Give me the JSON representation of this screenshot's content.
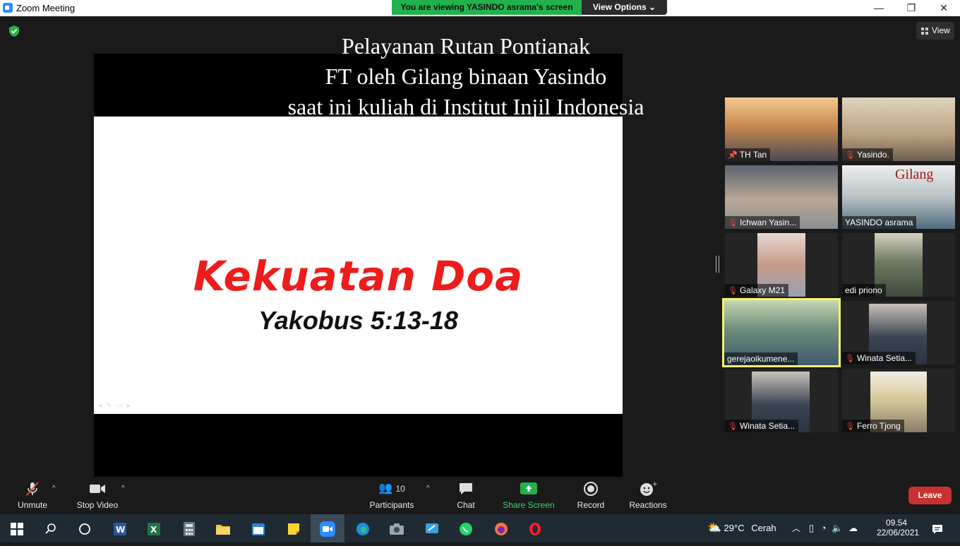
{
  "window": {
    "title": "Zoom Meeting",
    "share_banner": "You are viewing YASINDO asrama's screen",
    "view_options": "View Options",
    "minimize": "—",
    "restore": "❐",
    "close": "✕"
  },
  "view_button": "View",
  "shared_screen": {
    "caption_lines": [
      "Pelayanan Rutan Pontianak",
      "FT oleh Gilang binaan Yasindo",
      "saat ini kuliah di Institut Injil Indonesia"
    ],
    "slide_title": "Kekuatan Doa",
    "slide_subtitle": "Yakobus 5:13-18"
  },
  "participants": [
    {
      "name": "TH Tan",
      "muted": false,
      "pinned": true,
      "bg": "#b98f6a"
    },
    {
      "name": "Yasindo.",
      "muted": true,
      "bg": "#c7b59c"
    },
    {
      "name": "Ichwan Yasin...",
      "muted": true,
      "bg": "#7d8791"
    },
    {
      "name": "YASINDO asrama",
      "muted": false,
      "bg": "#9aa7a0",
      "overlay": "Gilang"
    },
    {
      "name": "Galaxy M21",
      "muted": true,
      "bg": "#caa79a"
    },
    {
      "name": "edi priono",
      "muted": false,
      "bg": "#5f6a58"
    },
    {
      "name": "gerejaoikumene...",
      "muted": false,
      "bg": "#6f8c7a"
    },
    {
      "name": "Winata Setia...",
      "muted": true,
      "bg": "#3c4450"
    },
    {
      "name": "Winata Setia...",
      "muted": true,
      "bg": "#3c4450"
    },
    {
      "name": "Ferro Tjong",
      "muted": true,
      "bg": "#d9c8a0"
    }
  ],
  "toolbar": {
    "unmute": "Unmute",
    "stop_video": "Stop Video",
    "participants": "Participants",
    "participants_count": "10",
    "chat": "Chat",
    "share_screen": "Share Screen",
    "record": "Record",
    "reactions": "Reactions",
    "leave": "Leave"
  },
  "taskbar": {
    "weather_temp": "29°C",
    "weather_text": "Cerah",
    "time": "09.54",
    "date": "22/06/2021"
  },
  "colors": {
    "share_green": "#22b24c",
    "leave_red": "#c8312f",
    "slide_red": "#ee1c1c",
    "active_speaker": "#f6f46b"
  }
}
